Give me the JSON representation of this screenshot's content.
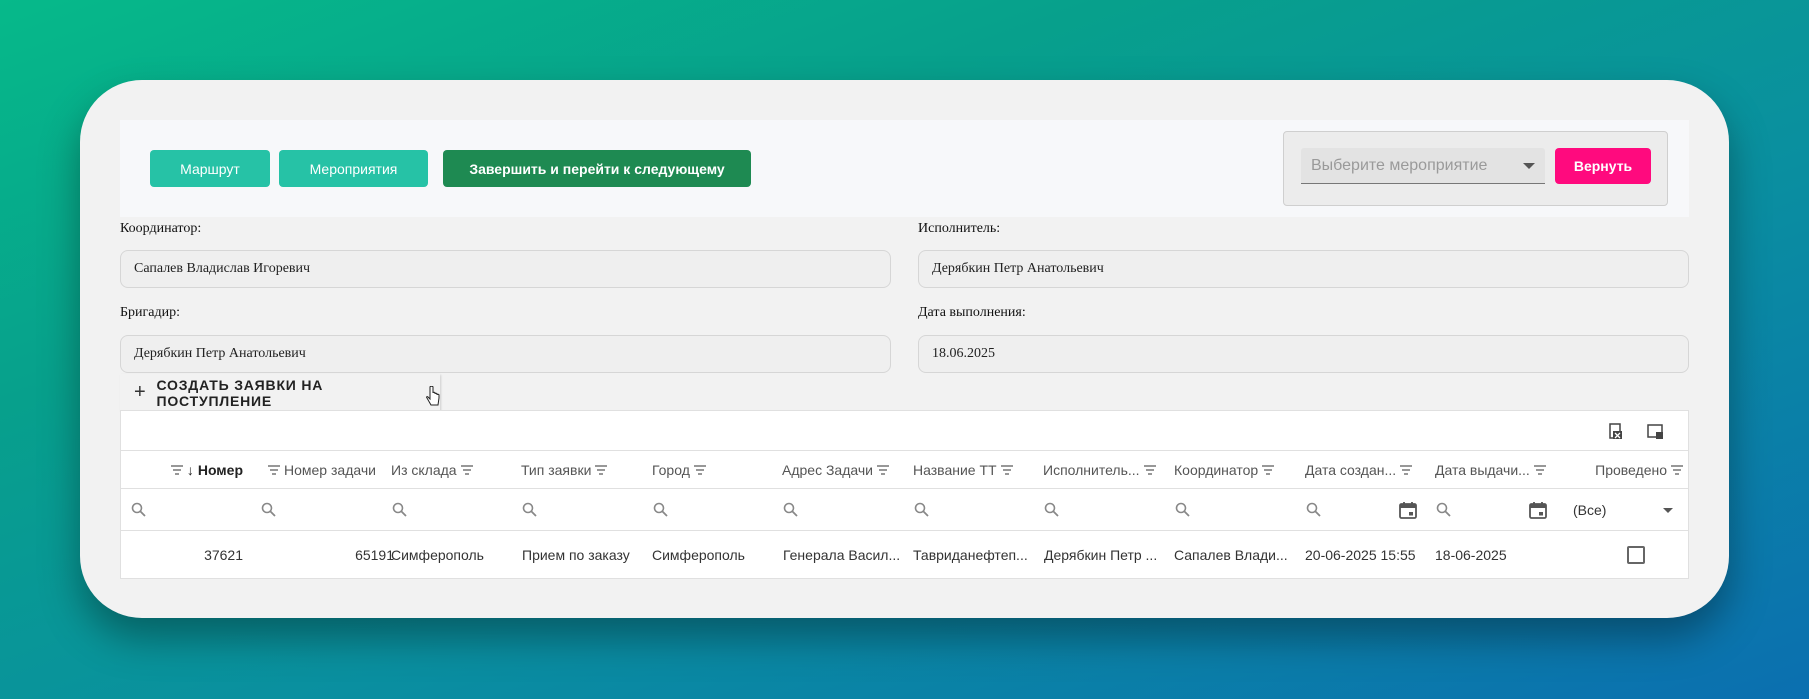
{
  "toolbar": {
    "route_label": "Маршрут",
    "events_label": "Мероприятия",
    "finish_label": "Завершить и перейти к следующему",
    "event_select_placeholder": "Выберите мероприятие",
    "return_label": "Вернуть"
  },
  "form": {
    "coordinator_label": "Координатор:",
    "coordinator_value": "Сапалев Владислав Игоревич",
    "executor_label": "Исполнитель:",
    "executor_value": "Дерябкин Петр Анатольевич",
    "foreman_label": "Бригадир:",
    "foreman_value": "Дерябкин Петр Анатольевич",
    "date_label": "Дата выполнения:",
    "date_value": "18.06.2025"
  },
  "create_button": {
    "label": "СОЗДАТЬ ЗАЯВКИ НА ПОСТУПЛЕНИЕ",
    "icon": "plus-icon"
  },
  "grid": {
    "toolbar_icons": [
      "export-excel-icon",
      "column-chooser-icon"
    ],
    "columns": [
      {
        "label": "Номер",
        "sort": "desc"
      },
      {
        "label": "Номер задачи"
      },
      {
        "label": "Из склада"
      },
      {
        "label": "Тип заявки"
      },
      {
        "label": "Город"
      },
      {
        "label": "Адрес Задачи"
      },
      {
        "label": "Название ТТ"
      },
      {
        "label": "Исполнитель..."
      },
      {
        "label": "Координатор"
      },
      {
        "label": "Дата создан..."
      },
      {
        "label": "Дата выдачи..."
      },
      {
        "label": "Проведено"
      }
    ],
    "filter_all_label": "(Все)",
    "rows": [
      {
        "number": "37621",
        "task_number": "65191",
        "from_warehouse": "Симферополь",
        "request_type": "Прием по заказу",
        "city": "Симферополь",
        "task_address": "Генерала Васил...",
        "tt_name": "Тавриданефтеп...",
        "executor": "Дерябкин Петр ...",
        "coordinator": "Сапалев Влади...",
        "created": "20-06-2025 15:55",
        "issued": "18-06-2025",
        "posted": false
      }
    ]
  }
}
